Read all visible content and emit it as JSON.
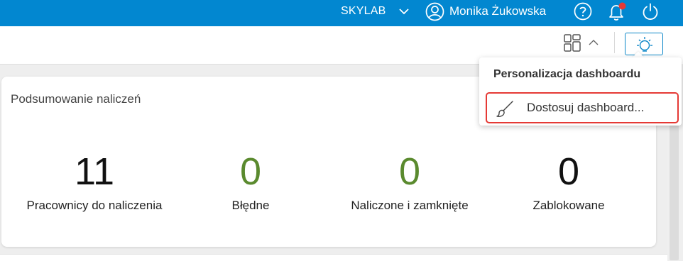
{
  "header": {
    "company": "SKYLAB",
    "user_name": "Monika Żukowska",
    "has_notification": true,
    "accent_color": "#0287d0"
  },
  "toolbar": {
    "layout_icon": "layout-grid-icon",
    "theme_icon": "lightbulb-icon"
  },
  "summary": {
    "title": "Podsumowanie naliczeń",
    "stats": [
      {
        "value": "11",
        "label": "Pracownicy do naliczenia",
        "color": "#111111"
      },
      {
        "value": "0",
        "label": "Błędne",
        "color": "#5a8a2e"
      },
      {
        "value": "0",
        "label": "Naliczone i zamknięte",
        "color": "#5a8a2e"
      },
      {
        "value": "0",
        "label": "Zablokowane",
        "color": "#111111"
      }
    ]
  },
  "dropdown": {
    "header": "Personalizacja dashboardu",
    "items": [
      {
        "label": "Dostosuj dashboard...",
        "icon": "brush-icon",
        "highlighted": true
      }
    ]
  }
}
